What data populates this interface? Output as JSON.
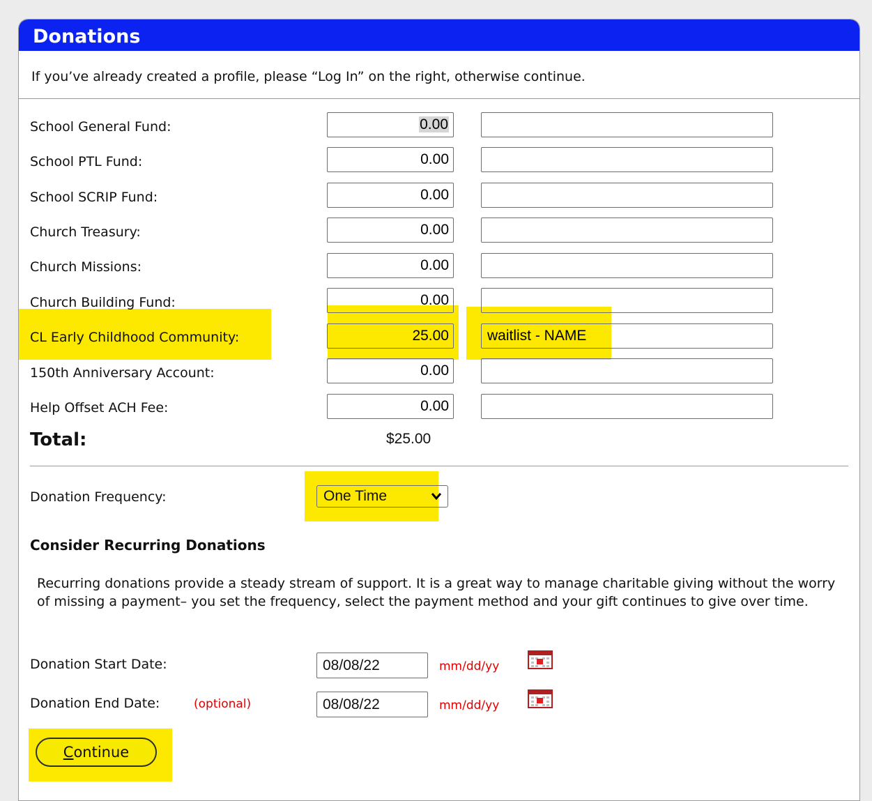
{
  "panel": {
    "title": "Donations",
    "intro": "If you’ve already created a profile, please “Log In” on the right, otherwise continue."
  },
  "funds": [
    {
      "label": "School General Fund:",
      "amount": "0.00",
      "memo": ""
    },
    {
      "label": "School PTL Fund:",
      "amount": "0.00",
      "memo": ""
    },
    {
      "label": "School SCRIP Fund:",
      "amount": "0.00",
      "memo": ""
    },
    {
      "label": "Church Treasury:",
      "amount": "0.00",
      "memo": ""
    },
    {
      "label": "Church Missions:",
      "amount": "0.00",
      "memo": ""
    },
    {
      "label": "Church Building Fund:",
      "amount": "0.00",
      "memo": ""
    },
    {
      "label": "CL Early Childhood Community:",
      "amount": "25.00",
      "memo": "waitlist - NAME",
      "highlighted": true
    },
    {
      "label": "150th Anniversary Account:",
      "amount": "0.00",
      "memo": ""
    },
    {
      "label": "Help Offset ACH Fee:",
      "amount": "0.00",
      "memo": ""
    }
  ],
  "total": {
    "label": "Total:",
    "value": "$25.00"
  },
  "frequency": {
    "label": "Donation Frequency:",
    "selected": "One Time",
    "highlighted": true
  },
  "recurring": {
    "title": "Consider Recurring Donations",
    "text": "Recurring donations provide a steady stream of support. It is a great way to manage charitable giving without the worry of missing a payment– you set the frequency, select the payment method and your gift continues to give over time."
  },
  "start_date": {
    "label": "Donation Start Date:",
    "value": "08/08/22",
    "format": "mm/dd/yy",
    "icon": "calendar-icon"
  },
  "end_date": {
    "label": "Donation End Date:",
    "optional": "(optional)",
    "value": "08/08/22",
    "format": "mm/dd/yy",
    "icon": "calendar-icon"
  },
  "continue_button": {
    "first_letter": "C",
    "rest": "ontinue"
  },
  "colors": {
    "header": "#0c22f0",
    "highlight": "#fde900",
    "required_text": "#e00000",
    "button": "#f8e900"
  }
}
